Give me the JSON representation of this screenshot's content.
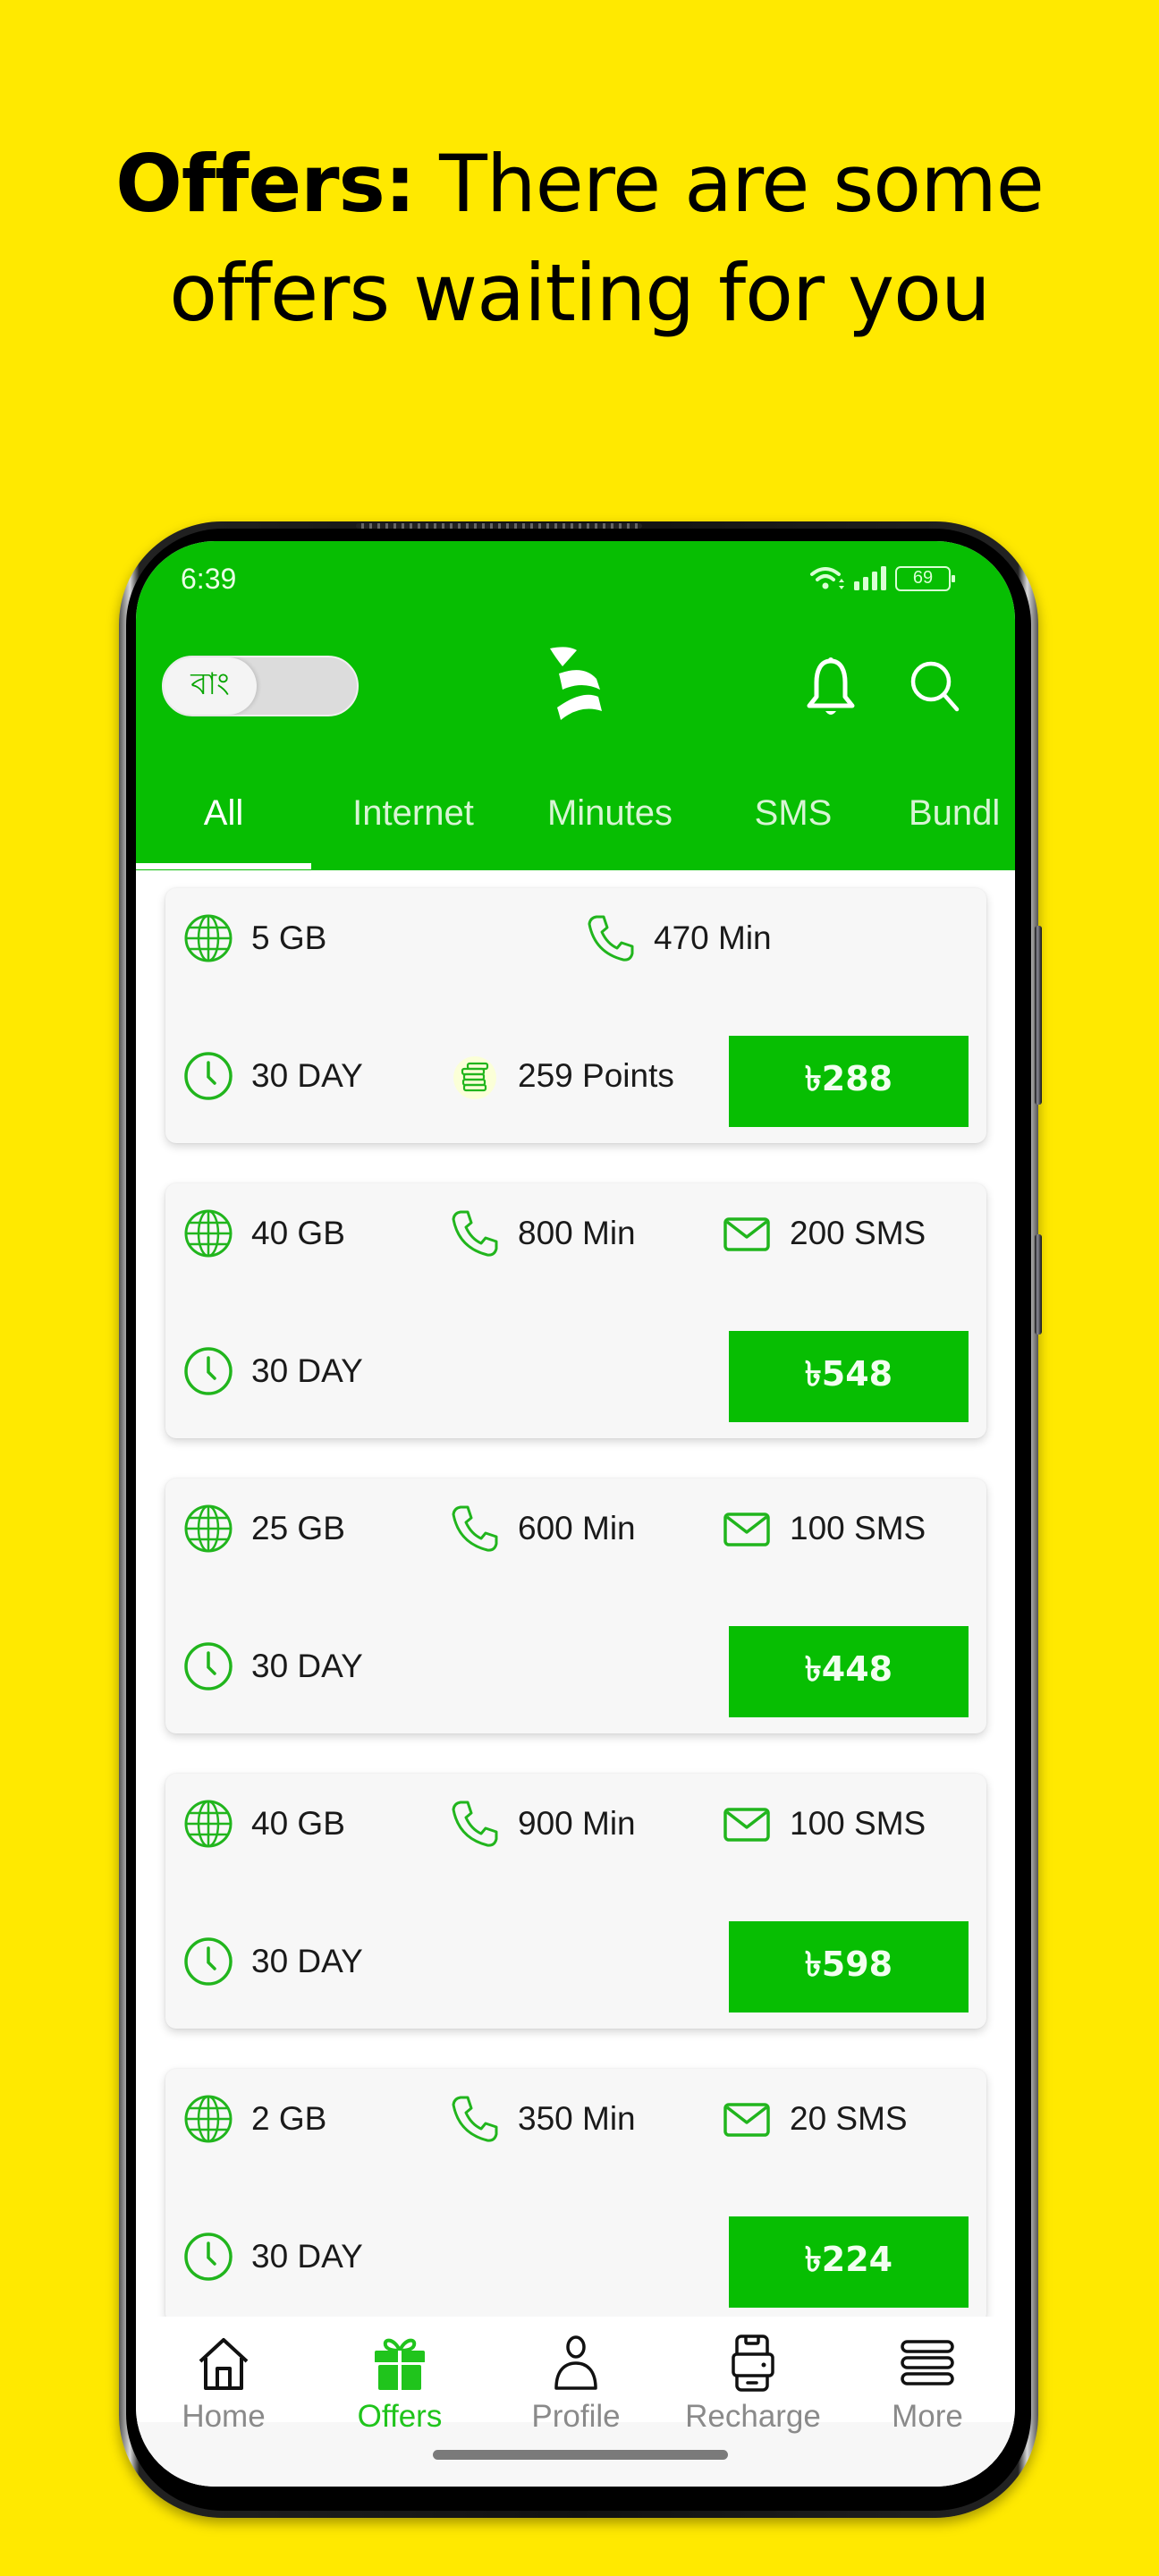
{
  "promo": {
    "headline_bold": "Offers:",
    "headline_rest_line1": " There are some",
    "headline_line2": "offers waiting for you"
  },
  "colors": {
    "background": "#FFE900",
    "brand_green": "#07BE02",
    "active_nav": "#20C41C"
  },
  "status_bar": {
    "time": "6:39",
    "battery": "69",
    "icons": [
      "wifi-icon",
      "signal-icon",
      "battery-icon"
    ]
  },
  "app_bar": {
    "language_toggle_label": "বাং",
    "logo": "brand-logo",
    "actions": [
      "bell-icon",
      "search-icon"
    ]
  },
  "tabs": [
    {
      "label": "All",
      "active": true
    },
    {
      "label": "Internet",
      "active": false
    },
    {
      "label": "Minutes",
      "active": false
    },
    {
      "label": "SMS",
      "active": false
    },
    {
      "label": "Bundl",
      "active": false
    }
  ],
  "offers": [
    {
      "data": "5 GB",
      "minutes": "470 Min",
      "sms": null,
      "validity": "30 DAY",
      "points": "259 Points",
      "price": "৳288"
    },
    {
      "data": "40 GB",
      "minutes": "800 Min",
      "sms": "200 SMS",
      "validity": "30 DAY",
      "points": null,
      "price": "৳548"
    },
    {
      "data": "25 GB",
      "minutes": "600 Min",
      "sms": "100 SMS",
      "validity": "30 DAY",
      "points": null,
      "price": "৳448"
    },
    {
      "data": "40 GB",
      "minutes": "900 Min",
      "sms": "100 SMS",
      "validity": "30 DAY",
      "points": null,
      "price": "৳598"
    },
    {
      "data": "2 GB",
      "minutes": "350 Min",
      "sms": "20 SMS",
      "validity": "30 DAY",
      "points": null,
      "price": "৳224"
    }
  ],
  "bottom_nav": [
    {
      "label": "Home",
      "icon": "home-icon",
      "active": false
    },
    {
      "label": "Offers",
      "icon": "gift-icon",
      "active": true
    },
    {
      "label": "Profile",
      "icon": "person-icon",
      "active": false
    },
    {
      "label": "Recharge",
      "icon": "recharge-icon",
      "active": false
    },
    {
      "label": "More",
      "icon": "menu-icon",
      "active": false
    }
  ]
}
